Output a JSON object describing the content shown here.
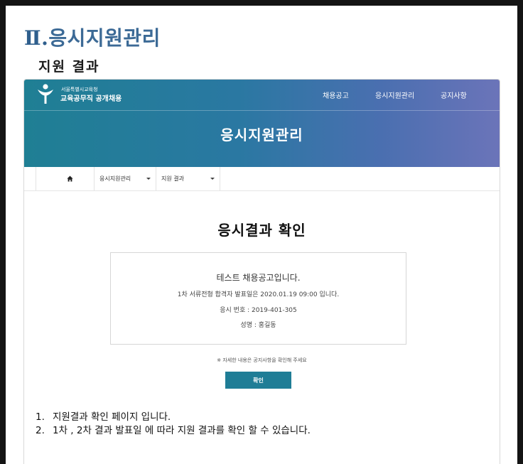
{
  "section": {
    "numeral": "Ⅱ.",
    "title": "응시지원관리"
  },
  "subtitle": "지원 결과",
  "site": {
    "brand_top": "서울특별시교육청",
    "brand_main": "교육공무직 공개채용",
    "nav": [
      "채용공고",
      "응시지원관리",
      "공지사항"
    ],
    "hero_title": "응시지원관리",
    "accent_color": "#1f7d96"
  },
  "breadcrumb": {
    "home_icon": "home-icon",
    "items": [
      "응시지원관리",
      "지원 결과"
    ]
  },
  "result": {
    "page_title": "응시결과 확인",
    "notice_title": "테스트 채용공고입니다.",
    "announce": "1차 서류전형 합격자 발표일은 2020.01.19 09:00 입니다.",
    "exam_number": "응시 번호 : 2019-401-305",
    "name": "성명 : 홍길동",
    "footnote": "※ 자세한 내용은 공지사항을 확인해 주세요",
    "confirm_label": "확인"
  },
  "notes": [
    {
      "num": "1.",
      "text": "지원결과 확인 페이지 입니다."
    },
    {
      "num": "2.",
      "text": "1차 , 2차 결과 발표일 에 따라 지원 결과를 확인 할 수 있습니다."
    }
  ]
}
